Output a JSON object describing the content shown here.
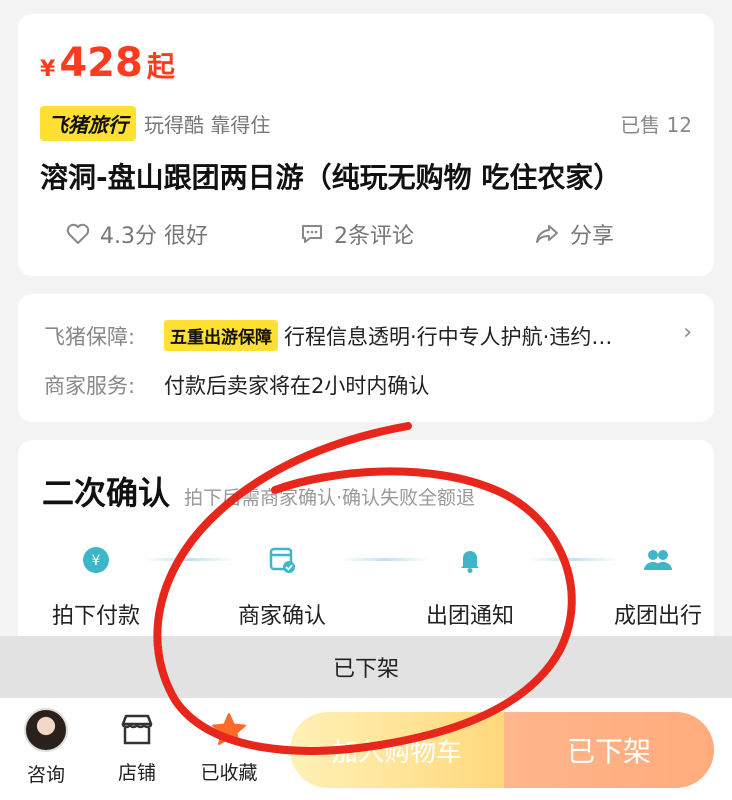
{
  "product": {
    "price_symbol": "¥",
    "price_value": "428",
    "price_suffix": "起",
    "brand_tag": "飞猪旅行",
    "brand_slogan": "玩得酷 靠得住",
    "sold_count": "已售 12",
    "title": "溶洞-盘山跟团两日游（纯玩无购物 吃住农家）",
    "rating": "4.3分 很好",
    "comments": "2条评论",
    "share": "分享"
  },
  "guarantee": {
    "label": "飞猪保障:",
    "tag": "五重出游保障",
    "text": "行程信息透明·行中专人护航·违约…",
    "merchant_label": "商家服务:",
    "merchant_text": "付款后卖家将在2小时内确认"
  },
  "confirm": {
    "title": "二次确认",
    "subtitle": "拍下后需商家确认·确认失败全额退",
    "steps": [
      {
        "label": "拍下付款",
        "icon": "yen-icon"
      },
      {
        "label": "商家确认",
        "icon": "shop-check-icon"
      },
      {
        "label": "出团通知",
        "icon": "bell-icon"
      },
      {
        "label": "成团出行",
        "icon": "group-icon"
      }
    ]
  },
  "status_banner": "已下架",
  "bottom_nav": {
    "consult": "咨询",
    "shop": "店铺",
    "favorite": "已收藏",
    "cart_button": "加入购物车",
    "off_button": "已下架"
  },
  "colors": {
    "accent_red": "#ff3b1f",
    "brand_yellow": "#ffe033",
    "step_teal": "#3fb6c8",
    "star_orange": "#ff6a2a"
  }
}
